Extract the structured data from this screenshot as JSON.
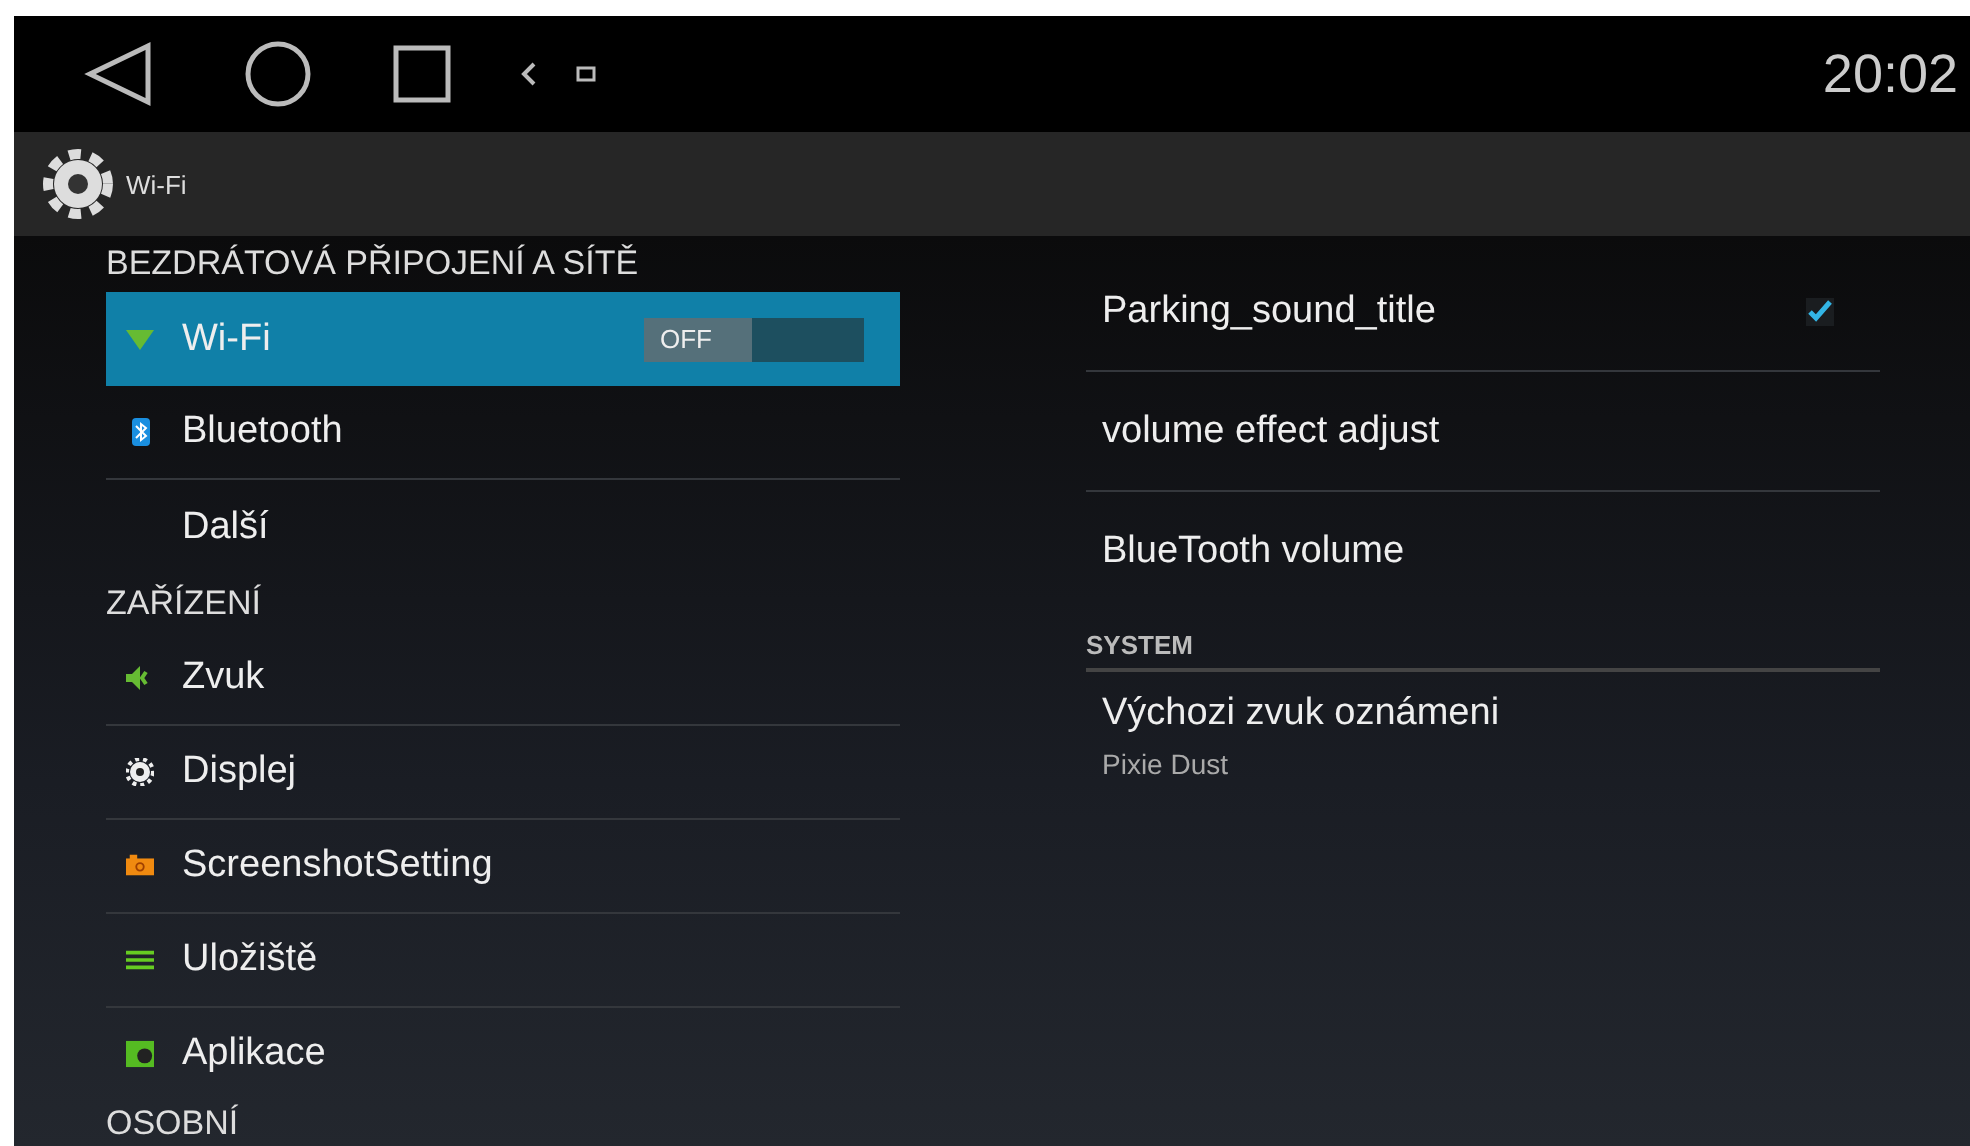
{
  "status_bar": {
    "time": "20:02"
  },
  "action_bar": {
    "title": "Wi-Fi"
  },
  "left_list": [
    {
      "kind": "header",
      "label": "BEZDRÁTOVÁ PŘIPOJENÍ A SÍTĚ"
    },
    {
      "kind": "item",
      "label": "Wi-Fi",
      "selected": true,
      "toggle": {
        "on": false,
        "label": "OFF"
      }
    },
    {
      "kind": "item",
      "label": "Bluetooth",
      "selected": false
    },
    {
      "kind": "item",
      "label": "Další",
      "selected": false
    },
    {
      "kind": "header",
      "label": "ZAŘÍZENÍ"
    },
    {
      "kind": "item",
      "label": "Zvuk",
      "selected": false
    },
    {
      "kind": "item",
      "label": "Displej",
      "selected": false
    },
    {
      "kind": "item",
      "label": "ScreenshotSetting",
      "selected": false
    },
    {
      "kind": "item",
      "label": "Uložiště",
      "selected": false
    },
    {
      "kind": "item",
      "label": "Aplikace",
      "selected": false
    },
    {
      "kind": "header",
      "label": "OSOBNÍ"
    }
  ],
  "right_list": [
    {
      "kind": "item",
      "label": "Parking_sound_title",
      "checked": true
    },
    {
      "kind": "item",
      "label": "volume effect adjust"
    },
    {
      "kind": "item",
      "label": "BlueTooth volume"
    },
    {
      "kind": "header",
      "label": "SYSTEM"
    },
    {
      "kind": "item",
      "label": "Výchozi zvuk oznámeni",
      "summary": "Pixie Dust"
    }
  ]
}
